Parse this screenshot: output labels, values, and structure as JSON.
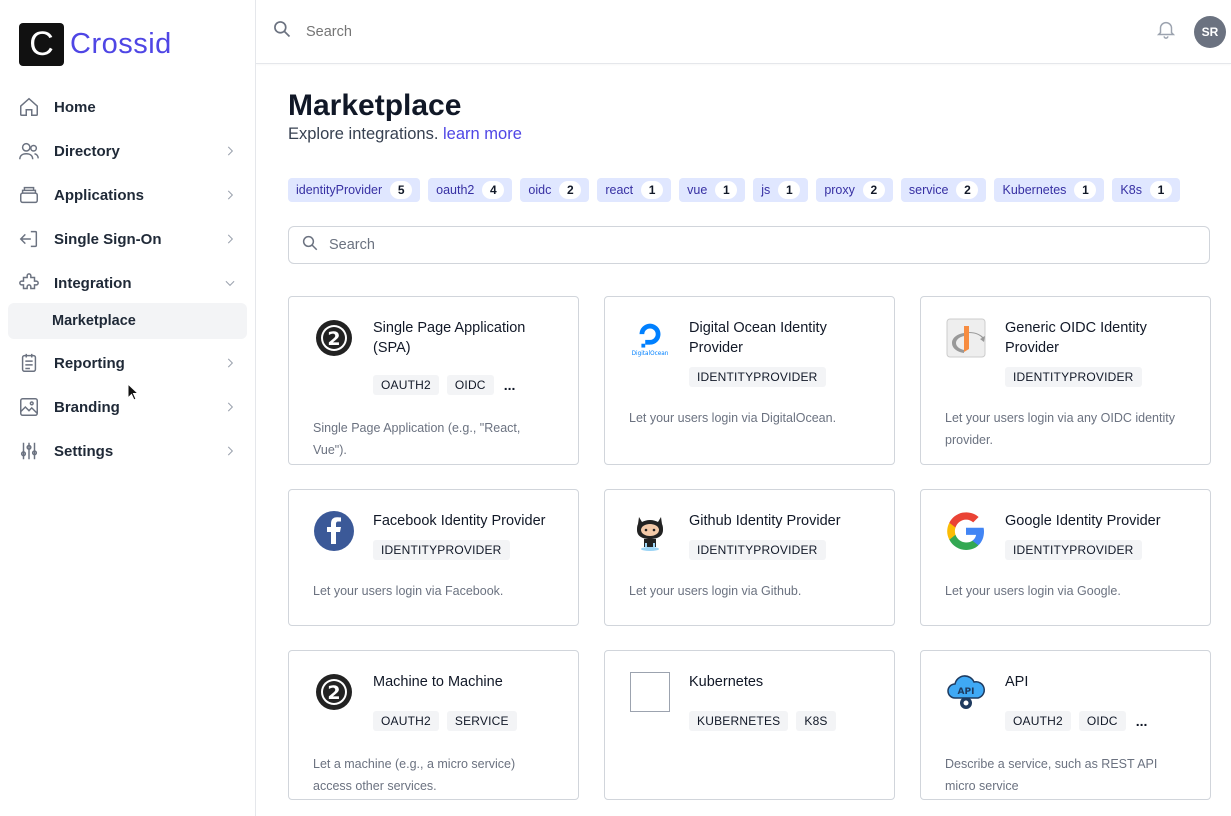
{
  "app": {
    "logo_letter": "C",
    "logo_text": "Crossid"
  },
  "sidebar": {
    "items": [
      {
        "label": "Home",
        "icon": "home-icon",
        "chevron": false
      },
      {
        "label": "Directory",
        "icon": "users-icon",
        "chevron": true
      },
      {
        "label": "Applications",
        "icon": "applications-icon",
        "chevron": true
      },
      {
        "label": "Single Sign-On",
        "icon": "sign-in-icon",
        "chevron": true
      },
      {
        "label": "Integration",
        "icon": "puzzle-icon",
        "chevron": true,
        "expanded": true
      },
      {
        "label": "Reporting",
        "icon": "clipboard-icon",
        "chevron": true
      },
      {
        "label": "Branding",
        "icon": "image-icon",
        "chevron": true
      },
      {
        "label": "Settings",
        "icon": "sliders-icon",
        "chevron": true
      }
    ],
    "sub_item": "Marketplace"
  },
  "topbar": {
    "search_placeholder": "Search",
    "avatar_initials": "SR"
  },
  "page": {
    "title": "Marketplace",
    "subtitle": "Explore integrations.",
    "learn_more": "learn more",
    "search_placeholder": "Search"
  },
  "tags": [
    {
      "label": "identityProvider",
      "count": "5"
    },
    {
      "label": "oauth2",
      "count": "4"
    },
    {
      "label": "oidc",
      "count": "2"
    },
    {
      "label": "react",
      "count": "1"
    },
    {
      "label": "vue",
      "count": "1"
    },
    {
      "label": "js",
      "count": "1"
    },
    {
      "label": "proxy",
      "count": "2"
    },
    {
      "label": "service",
      "count": "2"
    },
    {
      "label": "Kubernetes",
      "count": "1"
    },
    {
      "label": "K8s",
      "count": "1"
    }
  ],
  "cards": [
    {
      "title": "Single Page Application (SPA)",
      "badges": [
        "OAUTH2",
        "OIDC"
      ],
      "more": "...",
      "desc": "Single Page Application (e.g., \"React, Vue\").",
      "logo": "oauth2-icon"
    },
    {
      "title": "Digital Ocean Identity Provider",
      "badges": [
        "IDENTITYPROVIDER"
      ],
      "more": "",
      "desc": "Let your users login via DigitalOcean.",
      "logo": "digitalocean-icon",
      "logo_text": "DigitalOcean"
    },
    {
      "title": "Generic OIDC Identity Provider",
      "badges": [
        "IDENTITYPROVIDER"
      ],
      "more": "",
      "desc": "Let your users login via any OIDC identity provider.",
      "logo": "openid-icon"
    },
    {
      "title": "Facebook Identity Provider",
      "badges": [
        "IDENTITYPROVIDER"
      ],
      "more": "",
      "desc": "Let your users login via Facebook.",
      "logo": "facebook-icon"
    },
    {
      "title": "Github Identity Provider",
      "badges": [
        "IDENTITYPROVIDER"
      ],
      "more": "",
      "desc": "Let your users login via Github.",
      "logo": "github-icon"
    },
    {
      "title": "Google Identity Provider",
      "badges": [
        "IDENTITYPROVIDER"
      ],
      "more": "",
      "desc": "Let your users login via Google.",
      "logo": "google-icon"
    },
    {
      "title": "Machine to Machine",
      "badges": [
        "OAUTH2",
        "SERVICE"
      ],
      "more": "",
      "desc": "Let a machine (e.g., a micro service) access other services.",
      "logo": "oauth2-icon"
    },
    {
      "title": "Kubernetes",
      "badges": [
        "KUBERNETES",
        "K8S"
      ],
      "more": "",
      "desc": "",
      "logo": "kubernetes-placeholder-icon"
    },
    {
      "title": "API",
      "badges": [
        "OAUTH2",
        "OIDC"
      ],
      "more": "...",
      "desc": "Describe a service, such as REST API micro service",
      "logo": "api-cloud-icon",
      "logo_text": "API"
    }
  ],
  "colors": {
    "accent": "#4f46e5",
    "tag_bg": "#e0e7ff",
    "tag_fg": "#3730a3"
  }
}
